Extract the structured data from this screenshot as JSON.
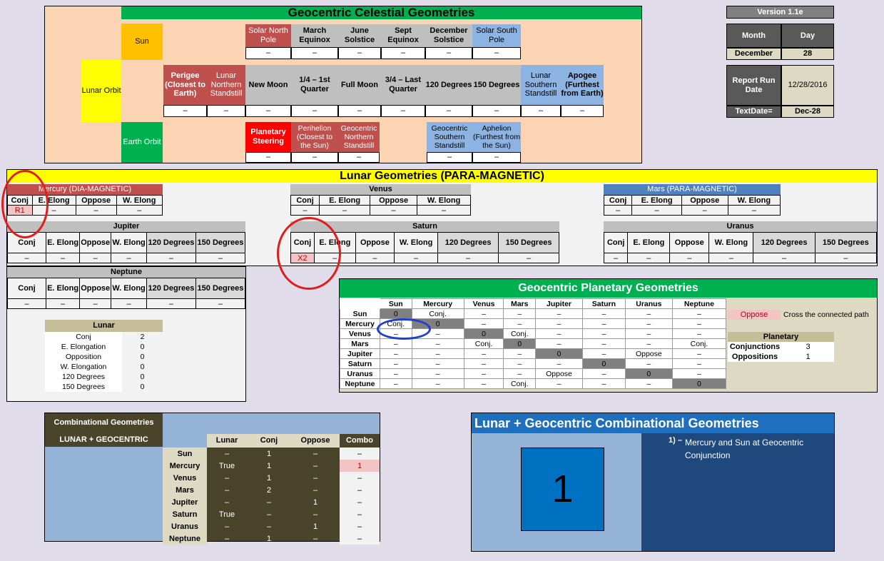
{
  "celestial": {
    "title": "Geocentric Celestial Geometries",
    "sun": "Sun",
    "lunar_orbit": "Lunar Orbit",
    "earth_orbit": "Earth Orbit",
    "row1": [
      "Solar North Pole",
      "March Equinox",
      "June Solstice",
      "Sept Equinox",
      "December Solstice",
      "Solar South Pole"
    ],
    "row2": [
      "Perigee (Closest to Earth)",
      "Lunar Northern Standstill",
      "New Moon",
      "1/4 – 1st Quarter",
      "Full Moon",
      "3/4 – Last Quarter",
      "120 Degrees",
      "150 Degrees",
      "Lunar Southern Standstill",
      "Apogee (Furthest from Earth)"
    ],
    "row3a": [
      "Planetary Steering",
      "Perihelion (Closest to the Sun)",
      "Geocentric Northern Standstill"
    ],
    "row3b": [
      "Geocentric Southern Standstill",
      "Aphelion (Furthest from the Sun)"
    ],
    "dash": "–"
  },
  "info": {
    "version": "Version 1.1e",
    "month_label": "Month",
    "day_label": "Day",
    "month": "December",
    "day": "28",
    "report_label": "Report Run Date",
    "report_value": "12/28/2016",
    "textdate_label": "TextDate=",
    "textdate_value": "Dec-28"
  },
  "lunar_geo": {
    "title": "Lunar Geometries (PARA-MAGNETIC)",
    "mercury": "Mercury (DIA-MAGNETIC)",
    "venus": "Venus",
    "mars": "Mars (PARA-MAGNETIC)",
    "jupiter": "Jupiter",
    "saturn": "Saturn",
    "uranus": "Uranus",
    "neptune": "Neptune",
    "cols4": [
      "Conj",
      "E. Elong",
      "Oppose",
      "W. Elong"
    ],
    "cols6": [
      "Conj",
      "E. Elong",
      "Oppose",
      "W. Elong",
      "120 Degrees",
      "150 Degrees"
    ],
    "mercury_conj": "R1",
    "saturn_conj": "X2",
    "dash": "–"
  },
  "lunar_summary": {
    "title": "Lunar",
    "rows": [
      {
        "label": "Conj",
        "value": "2"
      },
      {
        "label": "E. Elongation",
        "value": "0"
      },
      {
        "label": "Opposition",
        "value": "0"
      },
      {
        "label": "W. Elongation",
        "value": "0"
      },
      {
        "label": "120 Degrees",
        "value": "0"
      },
      {
        "label": "150 Degrees",
        "value": "0"
      }
    ]
  },
  "planetary": {
    "title": "Geocentric Planetary Geometries",
    "cols": [
      "Sun",
      "Mercury",
      "Venus",
      "Mars",
      "Jupiter",
      "Saturn",
      "Uranus",
      "Neptune"
    ],
    "rows": [
      {
        "name": "Sun",
        "cells": [
          "0",
          "Conj.",
          "–",
          "–",
          "–",
          "–",
          "–",
          "–"
        ]
      },
      {
        "name": "Mercury",
        "cells": [
          "Conj.",
          "0",
          "–",
          "–",
          "–",
          "–",
          "–",
          "–"
        ]
      },
      {
        "name": "Venus",
        "cells": [
          "–",
          "–",
          "0",
          "Conj.",
          "–",
          "–",
          "–",
          "–"
        ]
      },
      {
        "name": "Mars",
        "cells": [
          "–",
          "–",
          "Conj.",
          "0",
          "–",
          "–",
          "–",
          "Conj."
        ]
      },
      {
        "name": "Jupiter",
        "cells": [
          "–",
          "–",
          "–",
          "–",
          "0",
          "–",
          "Oppose",
          "–"
        ]
      },
      {
        "name": "Saturn",
        "cells": [
          "–",
          "–",
          "–",
          "–",
          "–",
          "0",
          "–",
          "–"
        ]
      },
      {
        "name": "Uranus",
        "cells": [
          "–",
          "–",
          "–",
          "–",
          "Oppose",
          "–",
          "0",
          "–"
        ]
      },
      {
        "name": "Neptune",
        "cells": [
          "–",
          "–",
          "–",
          "Conj.",
          "–",
          "–",
          "–",
          "0"
        ]
      }
    ],
    "legend_oppose": "Oppose",
    "legend_text": "Cross the connected path",
    "summary_title": "Planetary",
    "conj_label": "Conjunctions",
    "conj_value": "3",
    "opp_label": "Oppositions",
    "opp_value": "1"
  },
  "combinational": {
    "title1": "Combinational Geometries",
    "title2": "LUNAR + GEOCENTRIC",
    "cols": [
      "Lunar",
      "Conj",
      "Oppose",
      "Combo"
    ],
    "rows": [
      {
        "name": "Sun",
        "lunar": "–",
        "conj": "1",
        "oppose": "–",
        "combo": "–"
      },
      {
        "name": "Mercury",
        "lunar": "True",
        "conj": "1",
        "oppose": "–",
        "combo": "1"
      },
      {
        "name": "Venus",
        "lunar": "–",
        "conj": "1",
        "oppose": "–",
        "combo": "–"
      },
      {
        "name": "Mars",
        "lunar": "–",
        "conj": "2",
        "oppose": "–",
        "combo": "–"
      },
      {
        "name": "Jupiter",
        "lunar": "–",
        "conj": "–",
        "oppose": "1",
        "combo": "–"
      },
      {
        "name": "Saturn",
        "lunar": "True",
        "conj": "–",
        "oppose": "–",
        "combo": "–"
      },
      {
        "name": "Uranus",
        "lunar": "–",
        "conj": "–",
        "oppose": "1",
        "combo": "–"
      },
      {
        "name": "Neptune",
        "lunar": "–",
        "conj": "1",
        "oppose": "–",
        "combo": "–"
      }
    ]
  },
  "lg_combo": {
    "title": "Lunar + Geocentric Combinational Geometries",
    "count": "1",
    "item_num": "1) –",
    "item_text": "Mercury and Sun at Geocentric Conjunction"
  },
  "colors": {
    "peach": "#fbd4b4",
    "green": "#00b050",
    "yellow": "#ffff00",
    "orange": "#ffc000",
    "red": "#c0504d",
    "blue": "#8db3e2",
    "navy": "#1f497d",
    "olive": "#4a452a"
  }
}
